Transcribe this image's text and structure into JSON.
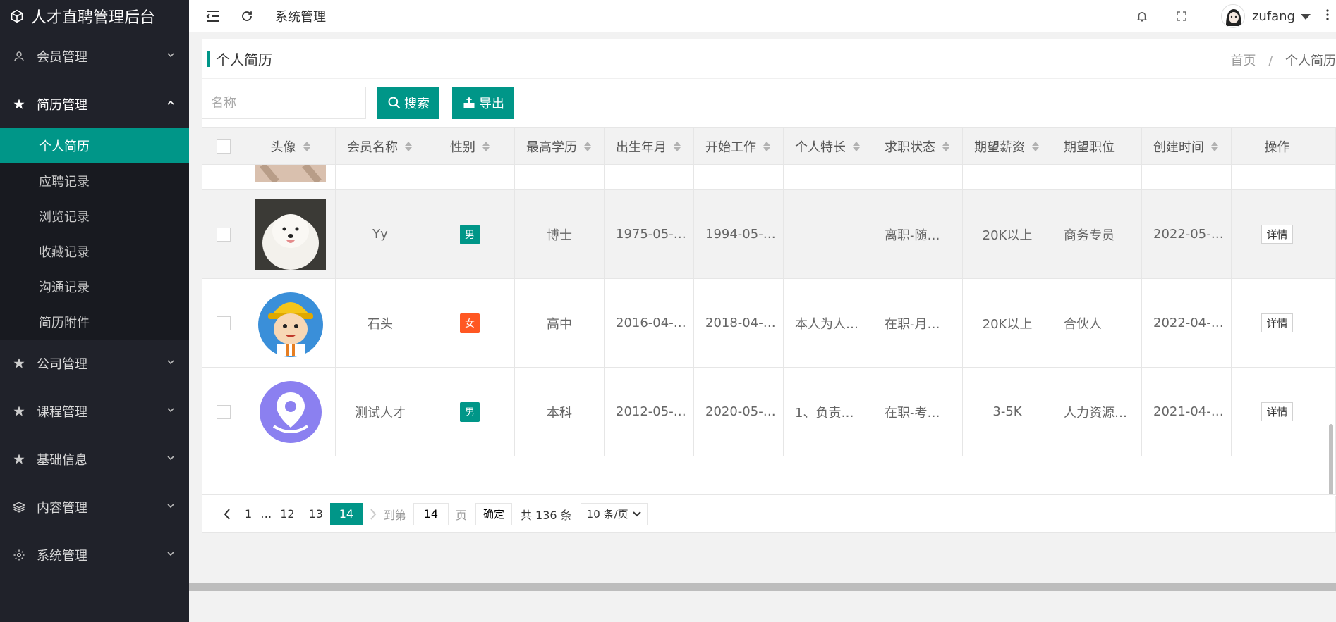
{
  "app": {
    "title": "人才直聘管理后台"
  },
  "sidebar": {
    "items": [
      {
        "label": "会员管理",
        "icon": "user-icon",
        "expanded": false
      },
      {
        "label": "简历管理",
        "icon": "star-icon",
        "expanded": true,
        "children": [
          "个人简历",
          "应聘记录",
          "浏览记录",
          "收藏记录",
          "沟通记录",
          "简历附件"
        ],
        "active": "个人简历"
      },
      {
        "label": "公司管理",
        "icon": "star-icon",
        "expanded": false
      },
      {
        "label": "课程管理",
        "icon": "star-icon",
        "expanded": false
      },
      {
        "label": "基础信息",
        "icon": "star-icon",
        "expanded": false
      },
      {
        "label": "内容管理",
        "icon": "layers-icon",
        "expanded": false
      },
      {
        "label": "系统管理",
        "icon": "gear-icon",
        "expanded": false
      }
    ]
  },
  "header": {
    "tab": "系统管理",
    "username": "zufang"
  },
  "page": {
    "title": "个人简历",
    "breadcrumb": {
      "home": "首页",
      "sep": "/",
      "current": "个人简历"
    }
  },
  "toolbar": {
    "search_placeholder": "名称",
    "search_label": "搜索",
    "export_label": "导出"
  },
  "table": {
    "columns": [
      "头像",
      "会员名称",
      "性别",
      "最高学历",
      "出生年月",
      "开始工作",
      "个人特长",
      "求职状态",
      "期望薪资",
      "期望职位",
      "创建时间",
      "操作"
    ],
    "detail_label": "详情",
    "rows": [
      {
        "avatar": "dog-photo",
        "name": "Yy",
        "sex": "男",
        "sex_color": "#009688",
        "edu": "博士",
        "birth": "1975-05-…",
        "start": "1994-05-…",
        "skill": "",
        "status": "离职-随…",
        "salary": "20K以上",
        "position": "商务专员",
        "created": "2022-05-…"
      },
      {
        "avatar": "cartoon-worker",
        "name": "石头",
        "sex": "女",
        "sex_color": "#ff5722",
        "edu": "高中",
        "birth": "2016-04-…",
        "start": "2018-04-…",
        "skill": "本人为人…",
        "status": "在职-月…",
        "salary": "20K以上",
        "position": "合伙人",
        "created": "2022-04-…"
      },
      {
        "avatar": "location-pin",
        "name": "测试人才",
        "sex": "男",
        "sex_color": "#009688",
        "edu": "本科",
        "birth": "2012-05-…",
        "start": "2020-05-…",
        "skill": "1、负责…",
        "status": "在职-考…",
        "salary": "3-5K",
        "position": "人力资源…",
        "created": "2021-04-…"
      }
    ]
  },
  "pager": {
    "pages": [
      "1",
      "…",
      "12",
      "13",
      "14"
    ],
    "current": "14",
    "goto_prefix": "到第",
    "goto_value": "14",
    "goto_suffix": "页",
    "confirm": "确定",
    "total": "共 136 条",
    "page_size": "10 条/页"
  }
}
